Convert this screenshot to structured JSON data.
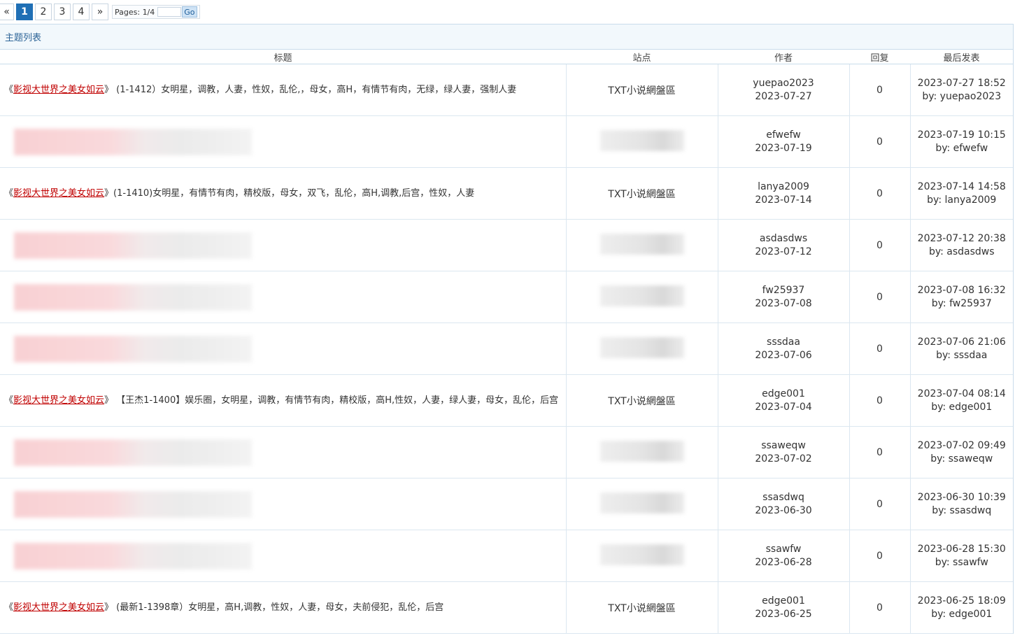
{
  "pager": {
    "first": "«",
    "pages": [
      "1",
      "2",
      "3",
      "4"
    ],
    "active": "1",
    "next": "»",
    "info": "Pages: 1/4",
    "go": "Go"
  },
  "list": {
    "section_title": "主题列表",
    "columns": [
      "标题",
      "站点",
      "作者",
      "回复",
      "最后发表"
    ],
    "rows": [
      {
        "book_open": "《",
        "book_name": "影视大世界之美女如云",
        "book_close": "》",
        "title_rest": " (1-1412）女明星，调教，人妻，性奴，乱伦,，母女，高H，有情节有肉，无绿，绿人妻，强制人妻",
        "site": "TXT小说網盤區",
        "author": "yuepao2023",
        "date": "2023-07-27",
        "replies": "0",
        "last_time": "2023-07-27 18:52",
        "last_by": "by: yuepao2023",
        "blurred": false
      },
      {
        "book_open": "",
        "book_name": "",
        "book_close": "",
        "title_rest": "",
        "site": "",
        "author": "efwefw",
        "date": "2023-07-19",
        "replies": "0",
        "last_time": "2023-07-19 10:15",
        "last_by": "by: efwefw",
        "blurred": true
      },
      {
        "book_open": "《",
        "book_name": "影视大世界之美女如云",
        "book_close": "》",
        "title_rest": "(1-1410)女明星，有情节有肉，精校版，母女，双飞，乱伦，高H,调教,后宫，性奴，人妻",
        "site": "TXT小说網盤區",
        "author": "lanya2009",
        "date": "2023-07-14",
        "replies": "0",
        "last_time": "2023-07-14 14:58",
        "last_by": "by: lanya2009",
        "blurred": false
      },
      {
        "book_open": "",
        "book_name": "",
        "book_close": "",
        "title_rest": "",
        "site": "",
        "author": "asdasdws",
        "date": "2023-07-12",
        "replies": "0",
        "last_time": "2023-07-12 20:38",
        "last_by": "by: asdasdws",
        "blurred": true
      },
      {
        "book_open": "",
        "book_name": "",
        "book_close": "",
        "title_rest": "",
        "site": "",
        "author": "fw25937",
        "date": "2023-07-08",
        "replies": "0",
        "last_time": "2023-07-08 16:32",
        "last_by": "by: fw25937",
        "blurred": true
      },
      {
        "book_open": "",
        "book_name": "",
        "book_close": "",
        "title_rest": "",
        "site": "",
        "author": "sssdaa",
        "date": "2023-07-06",
        "replies": "0",
        "last_time": "2023-07-06 21:06",
        "last_by": "by: sssdaa",
        "blurred": true
      },
      {
        "book_open": "《",
        "book_name": "影视大世界之美女如云",
        "book_close": "》",
        "title_rest": " 【王杰1-1400】娱乐圈，女明星，调教，有情节有肉，精校版，高H,性奴，人妻，绿人妻，母女，乱伦，后宫",
        "site": "TXT小说網盤區",
        "author": "edge001",
        "date": "2023-07-04",
        "replies": "0",
        "last_time": "2023-07-04 08:14",
        "last_by": "by: edge001",
        "blurred": false
      },
      {
        "book_open": "",
        "book_name": "",
        "book_close": "",
        "title_rest": "",
        "site": "",
        "author": "ssaweqw",
        "date": "2023-07-02",
        "replies": "0",
        "last_time": "2023-07-02 09:49",
        "last_by": "by: ssaweqw",
        "blurred": true
      },
      {
        "book_open": "",
        "book_name": "",
        "book_close": "",
        "title_rest": "",
        "site": "",
        "author": "ssasdwq",
        "date": "2023-06-30",
        "replies": "0",
        "last_time": "2023-06-30 10:39",
        "last_by": "by: ssasdwq",
        "blurred": true
      },
      {
        "book_open": "",
        "book_name": "",
        "book_close": "",
        "title_rest": "",
        "site": "",
        "author": "ssawfw",
        "date": "2023-06-28",
        "replies": "0",
        "last_time": "2023-06-28 15:30",
        "last_by": "by: ssawfw",
        "blurred": true
      },
      {
        "book_open": "《",
        "book_name": "影视大世界之美女如云",
        "book_close": "》",
        "title_rest": " (最新1-1398章）女明星，高H,调教，性奴，人妻，母女，夫前侵犯，乱伦，后宫",
        "site": "TXT小说網盤區",
        "author": "edge001",
        "date": "2023-06-25",
        "replies": "0",
        "last_time": "2023-06-25 18:09",
        "last_by": "by: edge001",
        "blurred": false
      }
    ]
  }
}
